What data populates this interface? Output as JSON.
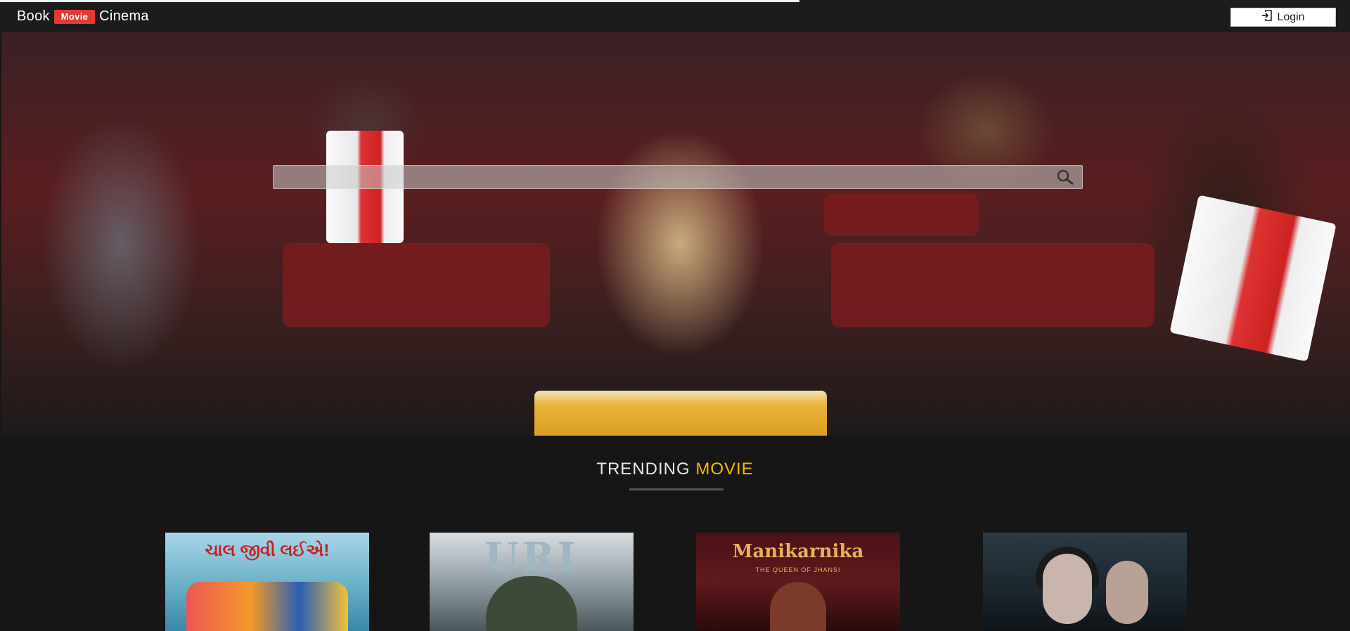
{
  "header": {
    "brand_left": "Book",
    "brand_badge": "Movie",
    "brand_right": "Cinema",
    "login_label": "Login",
    "login_icon": "sign-in-icon"
  },
  "hero": {
    "search_placeholder": "",
    "search_icon": "search-icon"
  },
  "trending": {
    "title_main": "TRENDING",
    "title_accent": "MOVIE",
    "accent_color": "#f5b800"
  },
  "posters": [
    {
      "title": "ચાલ જીવી લઈએ!"
    },
    {
      "title": "URI"
    },
    {
      "title": "Manikarnika",
      "subtitle": "THE QUEEN OF JHANSI"
    },
    {
      "title": ""
    }
  ],
  "colors": {
    "badge": "#e53935",
    "background": "#161616"
  }
}
